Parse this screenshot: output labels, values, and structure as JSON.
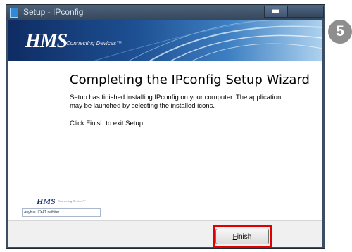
{
  "step_badge": "5",
  "window": {
    "title": "Setup - IPconfig",
    "minimize_glyph": "▬"
  },
  "banner": {
    "logo": "HMS",
    "tagline": "Connecting Devices™"
  },
  "wizard": {
    "title": "Completing the IPconfig Setup Wizard",
    "description": "Setup has finished installing IPconfig on your computer. The application may be launched by selecting the installed icons.",
    "instruction": "Click Finish to exit Setup."
  },
  "small_logo": {
    "logo": "HMS",
    "tagline": "Connecting Devices™",
    "brands": "Anybus  IXXAT  netbiter"
  },
  "buttons": {
    "finish_accel": "F",
    "finish_rest": "inish"
  },
  "colors": {
    "highlight": "#e00000",
    "banner_dark": "#0f2c63",
    "banner_light": "#aed2ef"
  }
}
